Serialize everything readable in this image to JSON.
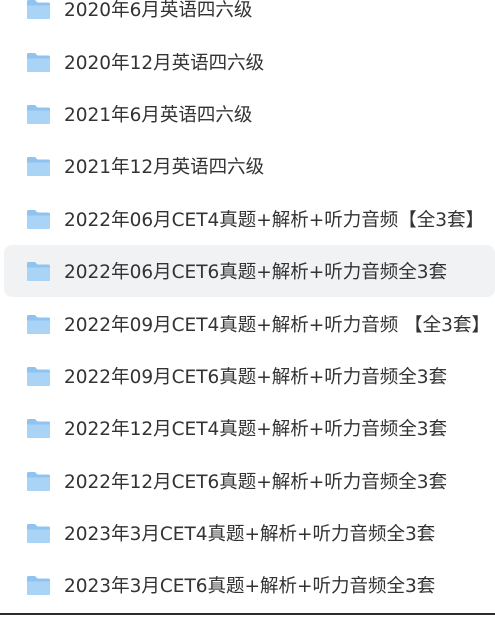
{
  "folders": [
    {
      "name": "2020年6月英语四六级",
      "selected": false
    },
    {
      "name": "2020年12月英语四六级",
      "selected": false
    },
    {
      "name": "2021年6月英语四六级",
      "selected": false
    },
    {
      "name": "2021年12月英语四六级",
      "selected": false
    },
    {
      "name": "2022年06月CET4真题+解析+听力音频【全3套】",
      "selected": false
    },
    {
      "name": "2022年06月CET6真题+解析+听力音频全3套",
      "selected": true
    },
    {
      "name": "2022年09月CET4真题+解析+听力音频 【全3套】",
      "selected": false
    },
    {
      "name": "2022年09月CET6真题+解析+听力音频全3套",
      "selected": false
    },
    {
      "name": "2022年12月CET4真题+解析+听力音频全3套",
      "selected": false
    },
    {
      "name": "2022年12月CET6真题+解析+听力音频全3套",
      "selected": false
    },
    {
      "name": "2023年3月CET4真题+解析+听力音频全3套",
      "selected": false
    },
    {
      "name": "2023年3月CET6真题+解析+听力音频全3套",
      "selected": false
    }
  ],
  "icon": "folder-icon",
  "colors": {
    "folder_back": "#8fc4f0",
    "folder_front": "#a9d4f6",
    "selected_bg": "#f1f2f4",
    "text": "#333333"
  }
}
